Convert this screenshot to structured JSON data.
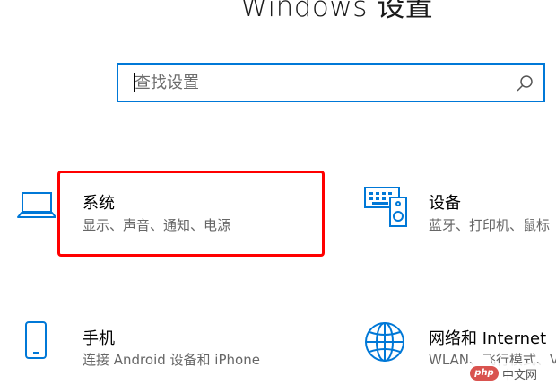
{
  "header": {
    "title": "Windows 设置"
  },
  "search": {
    "placeholder": "查找设置",
    "value": "",
    "icon": "search-icon"
  },
  "tiles": [
    {
      "title": "系统",
      "description": "显示、声音、通知、电源",
      "icon": "laptop-icon",
      "highlighted": true
    },
    {
      "title": "设备",
      "description": "蓝牙、打印机、鼠标",
      "icon": "keyboard-speaker-icon",
      "highlighted": false
    },
    {
      "title": "手机",
      "description": "连接 Android 设备和 iPhone",
      "icon": "phone-icon",
      "highlighted": false
    },
    {
      "title": "网络和 Internet",
      "description": "WLAN、飞行模式、VPN",
      "icon": "globe-icon",
      "highlighted": false
    }
  ],
  "colors": {
    "accent": "#0078d7",
    "highlight": "#ff0000",
    "description": "#666666"
  },
  "watermark": {
    "badge": "php",
    "text": "中文网"
  }
}
